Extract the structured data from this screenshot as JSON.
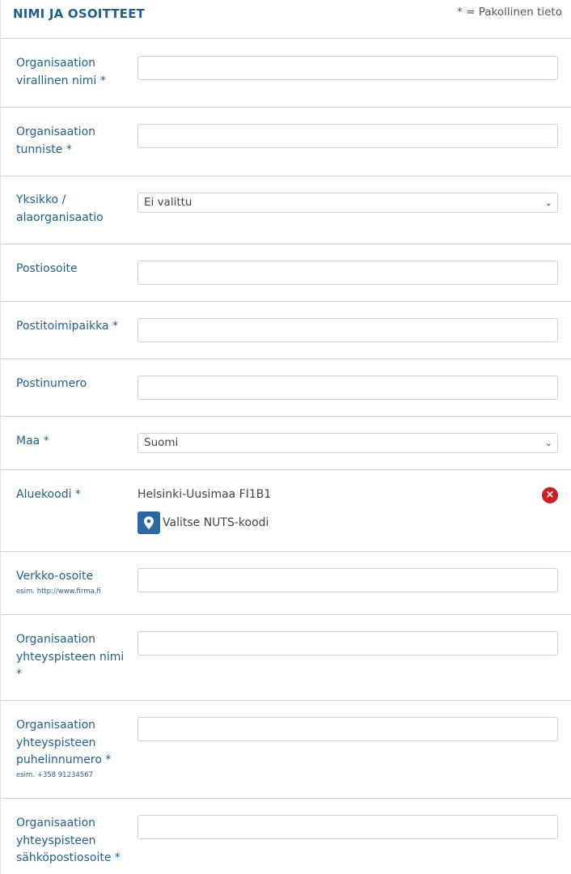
{
  "header": {
    "title": "NIMI JA OSOITTEET",
    "required_note": "* = Pakollinen tieto"
  },
  "fields": {
    "org_name": {
      "label": "Organisaation virallinen nimi *",
      "value": ""
    },
    "org_id": {
      "label": "Organisaation tunniste *",
      "value": ""
    },
    "unit": {
      "label": "Yksikko / alaorganisaatio",
      "selected": "Ei valittu"
    },
    "postal_address": {
      "label": "Postiosoite",
      "value": ""
    },
    "post_office": {
      "label": "Postitoimipaikka *",
      "value": ""
    },
    "postal_code": {
      "label": "Postinumero",
      "value": ""
    },
    "country": {
      "label": "Maa *",
      "selected": "Suomi"
    },
    "region": {
      "label": "Aluekoodi *",
      "value": "Helsinki-Uusimaa FI1B1",
      "select_button_label": "Valitse NUTS-koodi",
      "remove_icon": "close-circle-icon",
      "pin_icon": "map-pin-icon"
    },
    "website": {
      "label": "Verkko-osoite",
      "hint": "esim. http://www.firma.fi",
      "value": ""
    },
    "contact_name": {
      "label": "Organisaation yhteyspisteen nimi *",
      "value": ""
    },
    "contact_phone": {
      "label": "Organisaation yhteyspisteen puhelinnumero *",
      "hint": "esim. +358 91234567",
      "value": ""
    },
    "contact_email": {
      "label": "Organisaation yhteyspisteen sähköpostiosoite *",
      "value": ""
    }
  },
  "colors": {
    "label_text": "#1f5f8f",
    "button_blue": "#2a67a3",
    "remove_red": "#cc1f1f",
    "border": "#cfcfcf"
  }
}
